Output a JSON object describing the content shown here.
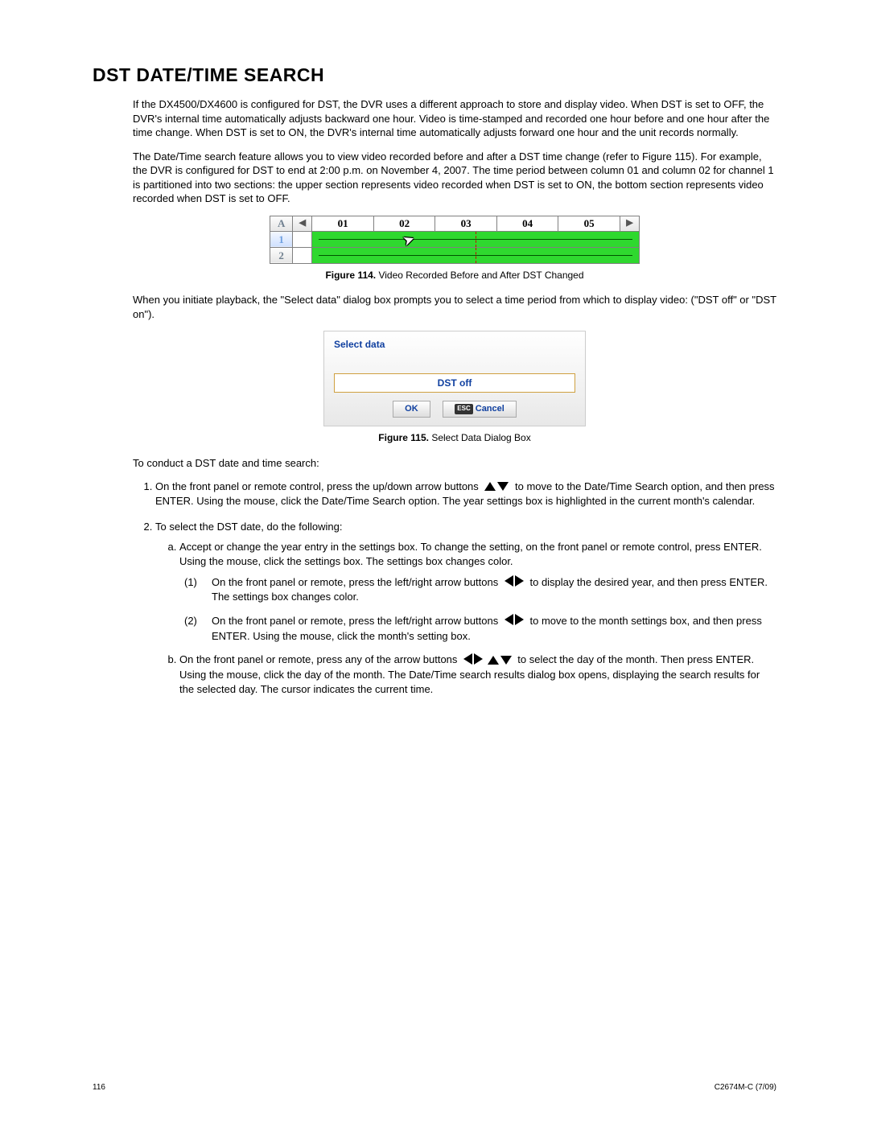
{
  "heading": "DST DATE/TIME SEARCH",
  "para1": "If the DX4500/DX4600 is configured for DST, the DVR uses a different approach to store and display video. When DST is set to OFF, the DVR's internal time automatically adjusts backward one hour. Video is time-stamped and recorded one hour before and one hour after the time change. When DST is set to ON, the DVR's internal time automatically adjusts forward one hour and the unit records normally.",
  "para2": "The Date/Time search feature allows you to view video recorded before and after a DST time change (refer to Figure 115). For example, the DVR is configured for DST to end at 2:00 p.m. on November 4, 2007. The time period between column 01 and column 02 for channel 1 is partitioned into two sections: the upper section represents video recorded when DST is set to ON, the bottom section represents video recorded when DST is set to OFF.",
  "fig114": {
    "label_bold": "Figure 114.",
    "label_rest": "  Video Recorded Before and After DST Changed",
    "rowA": "A",
    "row1": "1",
    "row2": "2",
    "cols": [
      "01",
      "02",
      "03",
      "04",
      "05"
    ],
    "left_arrow": "◀",
    "right_arrow": "▶"
  },
  "para3": "When you initiate playback, the \"Select data\" dialog box prompts you to select a time period from which to display video: (\"DST off\" or \"DST on\").",
  "fig115": {
    "title": "Select data",
    "field_value": "DST off",
    "ok_label": "OK",
    "esc_label": "ESC",
    "cancel_label": "Cancel",
    "caption_bold": "Figure 115.",
    "caption_rest": "  Select Data Dialog Box"
  },
  "lead_in": "To conduct a DST date and time search:",
  "steps": {
    "s1a": "On the front panel or remote control, press the up/down arrow buttons ",
    "s1b": " to move to the Date/Time Search option, and then press ENTER. Using the mouse, click the Date/Time Search option. The year settings box is highlighted in the current month's calendar.",
    "s2": "To select the DST date, do the following:",
    "s2a": "Accept or change the year entry in the settings box. To change the setting, on the front panel or remote control, press ENTER. Using the mouse, click the settings box. The settings box changes color.",
    "s2a1a": "On the front panel or remote, press the left/right arrow buttons ",
    "s2a1b": " to display the desired year, and then press ENTER. The settings box changes color.",
    "s2a2a": "On the front panel or remote, press the left/right arrow buttons ",
    "s2a2b": " to move to the month settings box, and then press ENTER. Using the mouse, click the month's setting box.",
    "s2ba": "On the front panel or remote, press any of the arrow buttons ",
    "s2bb": " to select the day of the month. Then press ENTER. Using the mouse, click the day of the month. The Date/Time search results dialog box opens, displaying the search results for the selected day. The cursor indicates the current time."
  },
  "footer": {
    "page": "116",
    "docid": "C2674M-C (7/09)"
  }
}
